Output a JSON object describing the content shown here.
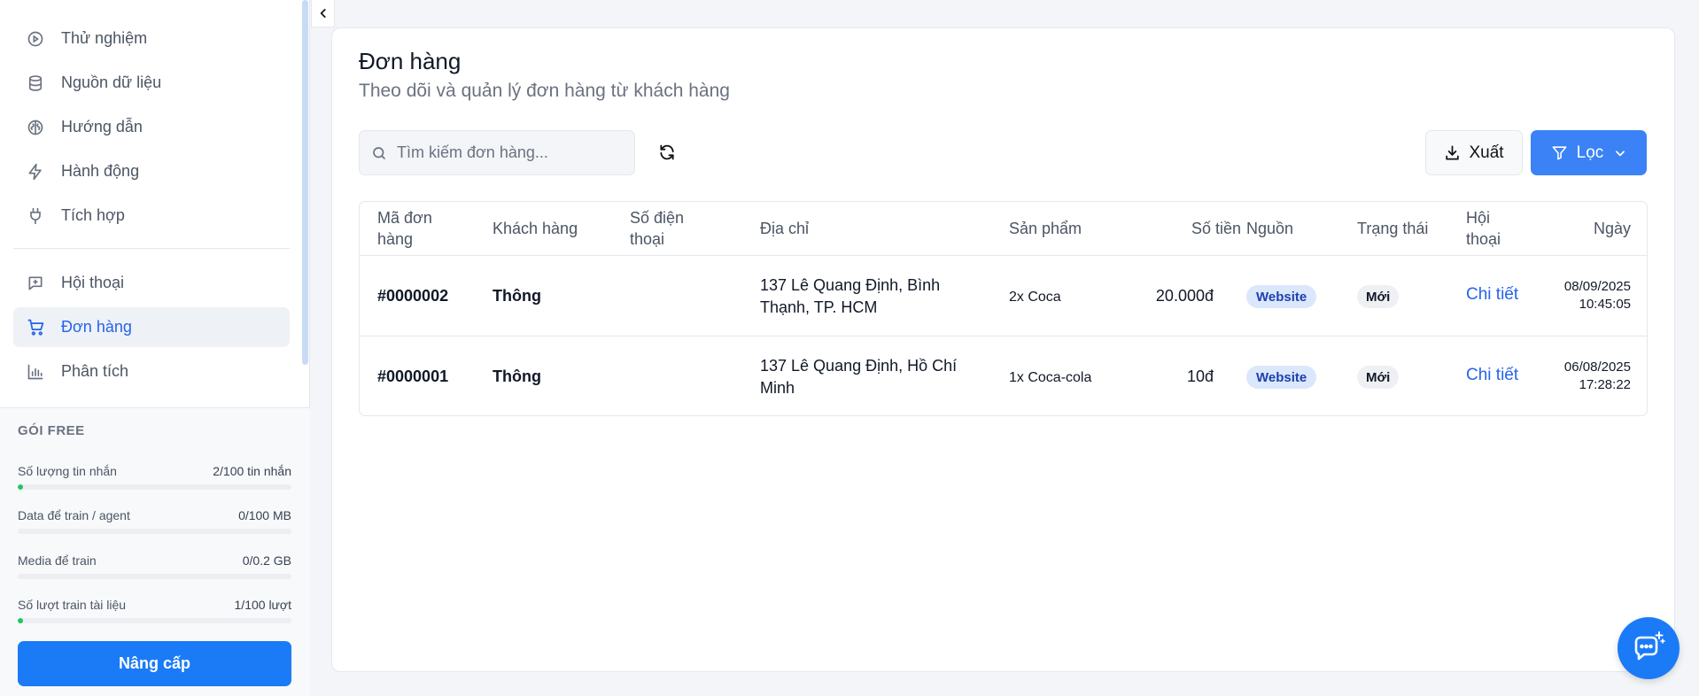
{
  "sidebar": {
    "nav": [
      {
        "label": "Thử nghiệm",
        "icon": "play-circle-icon"
      },
      {
        "label": "Nguồn dữ liệu",
        "icon": "database-icon"
      },
      {
        "label": "Hướng dẫn",
        "icon": "brain-icon"
      },
      {
        "label": "Hành động",
        "icon": "zap-icon"
      },
      {
        "label": "Tích hợp",
        "icon": "plug-icon"
      },
      {
        "label": "Hội thoại",
        "icon": "message-plus-icon"
      },
      {
        "label": "Đơn hàng",
        "icon": "cart-icon",
        "active": true
      },
      {
        "label": "Phân tích",
        "icon": "bar-chart-icon"
      }
    ],
    "plan": {
      "title": "GÓI FREE",
      "quotas": [
        {
          "label": "Số lượng tin nhắn",
          "value": "2/100 tin nhắn",
          "ratio": 0.02
        },
        {
          "label": "Data để train / agent",
          "value": "0/100 MB",
          "ratio": 0
        },
        {
          "label": "Media để train",
          "value": "0/0.2 GB",
          "ratio": 0
        },
        {
          "label": "Số lượt train tài liệu",
          "value": "1/100 lượt",
          "ratio": 0.01
        }
      ],
      "upgrade_label": "Nâng cấp"
    }
  },
  "main": {
    "title": "Đơn hàng",
    "subtitle": "Theo dõi và quản lý đơn hàng từ khách hàng",
    "search_placeholder": "Tìm kiếm đơn hàng...",
    "export_label": "Xuất",
    "filter_label": "Lọc",
    "table": {
      "headers": {
        "order_id": [
          "Mã đơn",
          "hàng"
        ],
        "customer": "Khách hàng",
        "phone": [
          "Số điện",
          "thoại"
        ],
        "address": "Địa chỉ",
        "product": "Sản phẩm",
        "amount": "Số tiền",
        "source": "Nguồn",
        "status": "Trạng thái",
        "conversation": [
          "Hội",
          "thoại"
        ],
        "date": "Ngày"
      },
      "rows": [
        {
          "order_id": "#0000002",
          "customer": "Thông",
          "phone": "",
          "address": [
            "137 Lê Quang Định, Bình",
            "Thạnh, TP. HCM"
          ],
          "product": "2x Coca",
          "amount": "20.000đ",
          "source": "Website",
          "status": "Mới",
          "conversation": "Chi tiết",
          "date": "08/09/2025",
          "time": "10:45:05"
        },
        {
          "order_id": "#0000001",
          "customer": "Thông",
          "phone": "",
          "address": [
            "137 Lê Quang Định, Hồ Chí",
            "Minh"
          ],
          "product": "1x Coca-cola",
          "amount": "10đ",
          "source": "Website",
          "status": "Mới",
          "conversation": "Chi tiết",
          "date": "06/08/2025",
          "time": "17:28:22"
        }
      ]
    }
  },
  "colors": {
    "accent": "#1b7bf7",
    "link": "#2563eb",
    "progress": "#22c55e"
  }
}
